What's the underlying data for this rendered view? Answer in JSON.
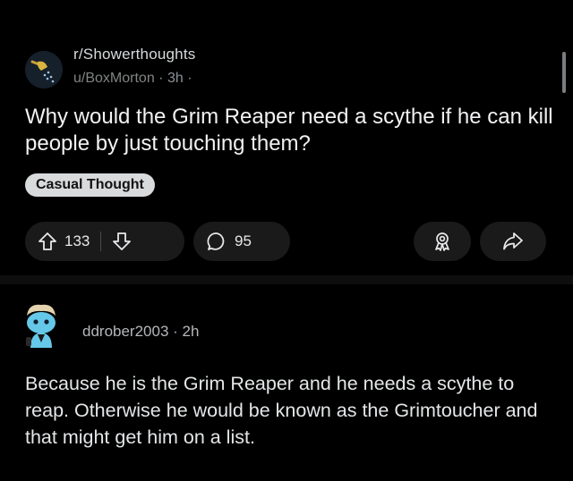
{
  "post": {
    "subreddit": "r/Showerthoughts",
    "author": "u/BoxMorton",
    "age": "3h",
    "title": "Why would the Grim Reaper need a scythe if he can kill people by just touching them?",
    "flair": "Casual Thought",
    "upvotes": "133",
    "comments": "95"
  },
  "comment": {
    "author": "ddrober2003",
    "age": "2h",
    "body": "Because he is the Grim Reaper and he needs a scythe to reap. Otherwise he would be known as the Grimtoucher and that might get him on a list."
  },
  "icons": {
    "subreddit": "showerthoughts-icon",
    "upvote": "upvote-arrow-icon",
    "downvote": "downvote-arrow-icon",
    "comment": "comment-bubble-icon",
    "award": "award-icon",
    "share": "share-arrow-icon"
  },
  "colors": {
    "background": "#000000",
    "pill": "#1a1a1b",
    "flair_bg": "#d8dadc",
    "meta_text": "#8c9196"
  }
}
